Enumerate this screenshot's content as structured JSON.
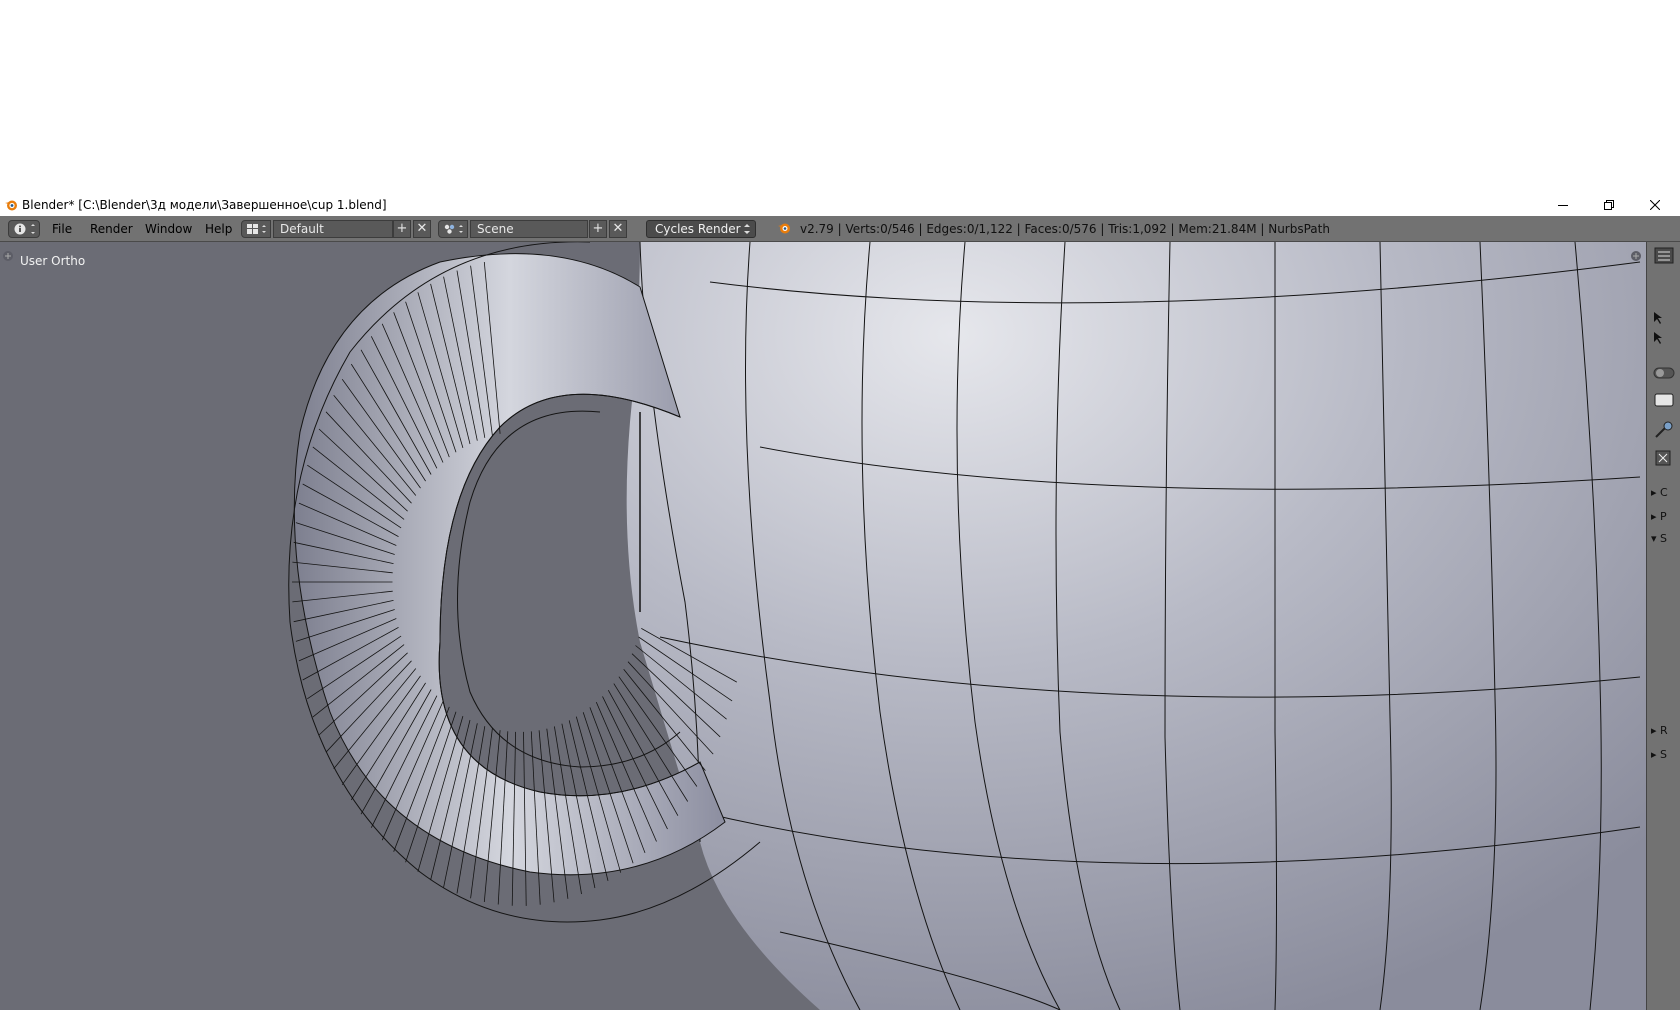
{
  "window": {
    "title": "Blender* [C:\\Blender\\3д модели\\Завершенное\\cup 1.blend]",
    "controls": {
      "minimize": "minimize-icon",
      "restore": "restore-icon",
      "close": "close-icon"
    }
  },
  "header": {
    "menus": [
      "File",
      "Render",
      "Window",
      "Help"
    ],
    "layout": "Default",
    "scene": "Scene",
    "render_engine": "Cycles Render",
    "stats": "v2.79 | Verts:0/546 | Edges:0/1,122 | Faces:0/576 | Tris:1,092 | Mem:21.84M | NurbsPath"
  },
  "viewport": {
    "view_label": "User Ortho"
  },
  "right_panel": {
    "collapsed_labels": [
      "C",
      "P",
      "S",
      "R",
      "S"
    ]
  },
  "colors": {
    "header_bg": "#727272",
    "viewport_bg": "#6b6c75",
    "mesh_surface": "#b4b6c6",
    "wire": "#111111"
  }
}
